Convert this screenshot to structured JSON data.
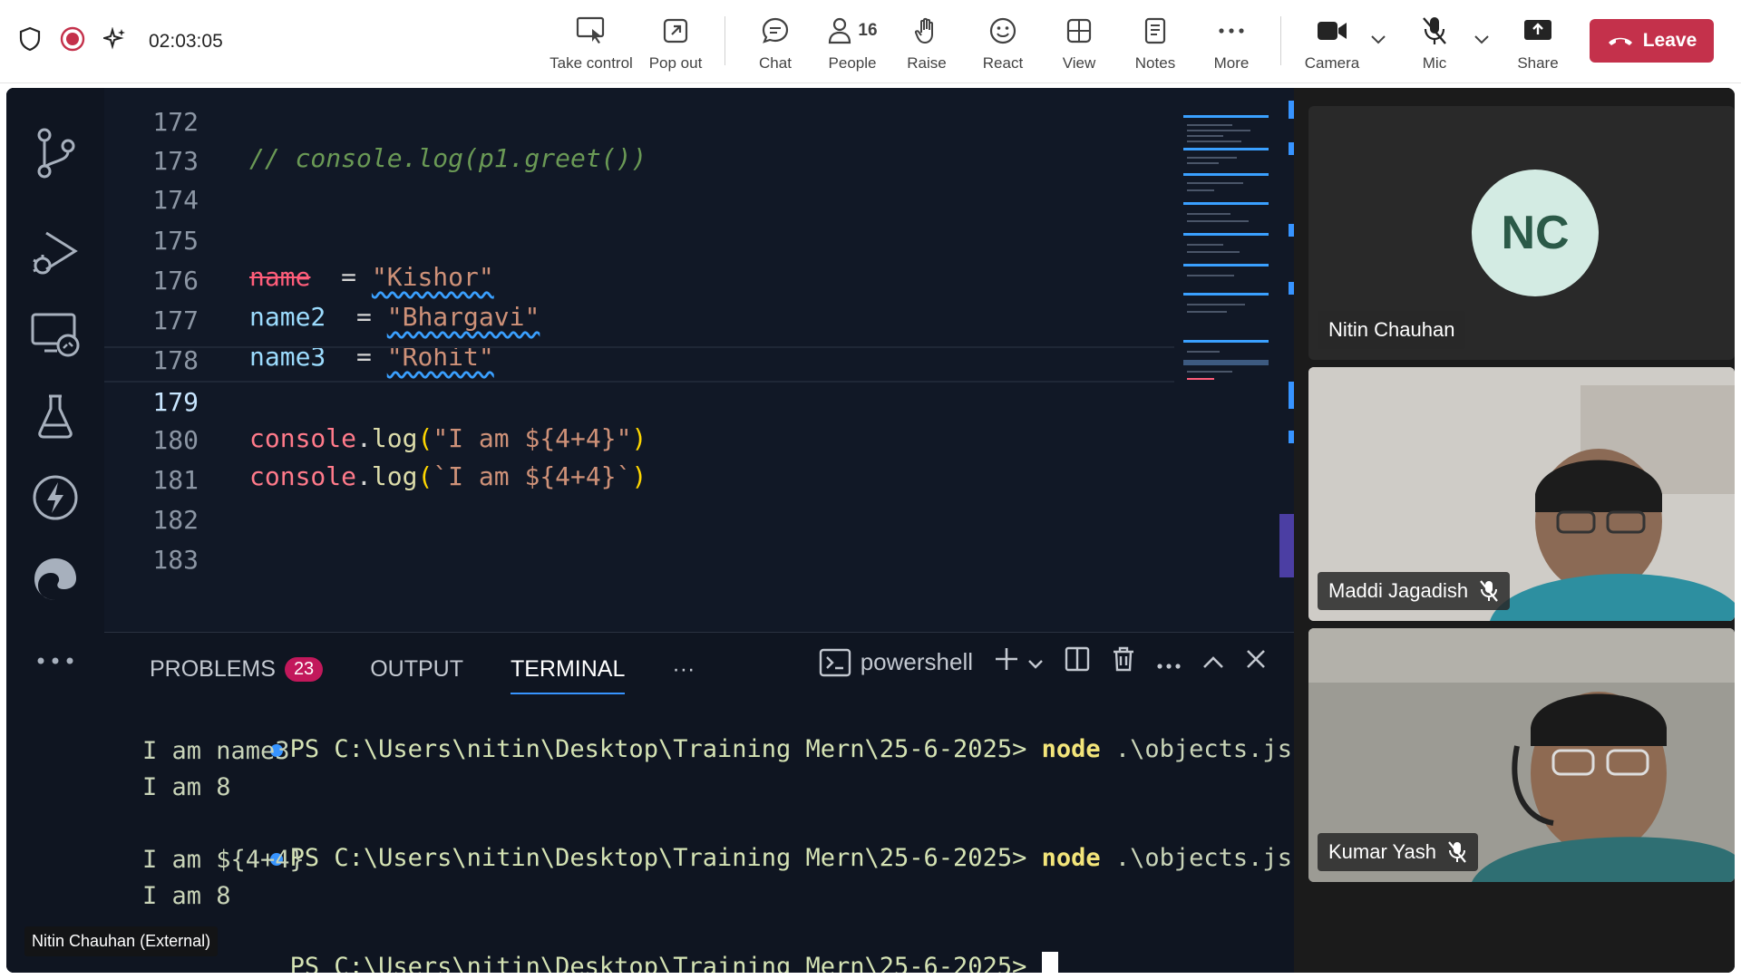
{
  "toolbar": {
    "timer": "02:03:05",
    "buttons": {
      "take_control": "Take control",
      "pop_out": "Pop out",
      "chat": "Chat",
      "people": "People",
      "people_count": "16",
      "raise": "Raise",
      "react": "React",
      "view": "View",
      "notes": "Notes",
      "more": "More",
      "camera": "Camera",
      "mic": "Mic",
      "share": "Share"
    },
    "leave": "Leave"
  },
  "editor": {
    "lines": [
      {
        "num": "172",
        "code": "// console.log(p1.greet())"
      },
      {
        "num": "173",
        "code": ""
      },
      {
        "num": "174",
        "code": ""
      },
      {
        "num": "175",
        "var": "name",
        "eq": "  = ",
        "str": "\"Kishor\""
      },
      {
        "num": "176",
        "var": "name2",
        "eq": "  = ",
        "str": "\"Bhargavi\""
      },
      {
        "num": "177",
        "var": "name3",
        "eq": "  = ",
        "str": "\"Rohit\""
      },
      {
        "num": "178",
        "code": ""
      },
      {
        "num": "179",
        "fn": "console",
        "dot": ".",
        "log": "log",
        "open": "(",
        "str": "\"I am ${4+4}\"",
        "close": ")"
      },
      {
        "num": "180",
        "fn": "console",
        "dot": ".",
        "log": "log",
        "open": "(",
        "str": "`I am ${4+4}`",
        "close": ")"
      },
      {
        "num": "181",
        "code": ""
      },
      {
        "num": "182",
        "code": ""
      },
      {
        "num": "183",
        "code": ""
      }
    ]
  },
  "panel": {
    "tabs": {
      "problems": "PROBLEMS",
      "problems_count": "23",
      "output": "OUTPUT",
      "terminal": "TERMINAL",
      "more": "···"
    },
    "shell": "powershell",
    "terminal_lines": [
      {
        "prompt": "PS C:\\Users\\nitin\\Desktop\\Training Mern\\25-6-2025> ",
        "cmd": "node",
        "arg": " .\\objects.js"
      },
      {
        "out": "I am name3"
      },
      {
        "out": "I am 8"
      },
      {
        "prompt": "PS C:\\Users\\nitin\\Desktop\\Training Mern\\25-6-2025> ",
        "cmd": "node",
        "arg": " .\\objects.js"
      },
      {
        "out": "I am ${4+4}"
      },
      {
        "out": "I am 8"
      },
      {
        "prompt": "PS C:\\Users\\nitin\\Desktop\\Training Mern\\25-6-2025> "
      }
    ]
  },
  "presenter_label": "Nitin Chauhan (External)",
  "participants": [
    {
      "name": "Nitin Chauhan",
      "initials": "NC"
    },
    {
      "name": "Maddi Jagadish",
      "muted": true
    },
    {
      "name": "Kumar Yash",
      "muted": true
    }
  ],
  "colors": {
    "leave": "#c4314b",
    "terminal_accent": "#3794ff",
    "problems_badge": "#c2185b"
  }
}
